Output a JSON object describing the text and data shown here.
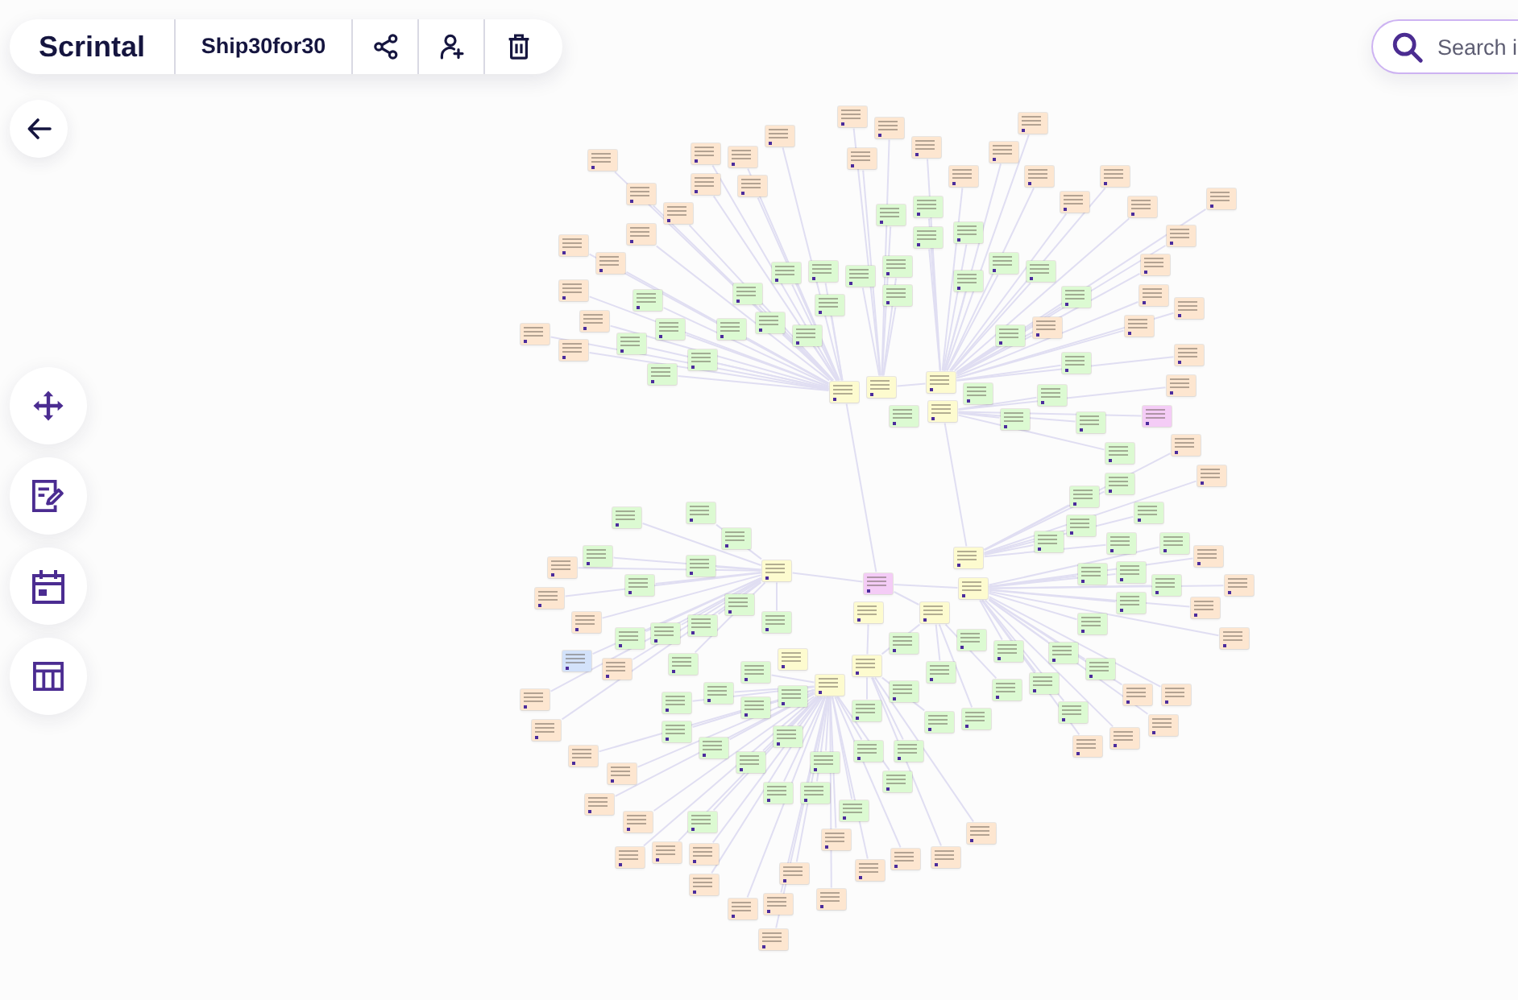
{
  "toolbar": {
    "logo": "Scrintal",
    "board_title": "Ship30for30"
  },
  "search": {
    "placeholder": "Search i"
  },
  "board": {
    "cards": [
      {
        "color": "#fde6d0"
      },
      {
        "color": "#fde6d0"
      },
      {
        "color": "#fde6d0"
      },
      {
        "color": "#fde6d0"
      },
      {
        "color": "#fde6d0"
      },
      {
        "color": "#fde6d0"
      },
      {
        "color": "#fde6d0"
      },
      {
        "color": "#fde6d0"
      },
      {
        "color": "#fde6d0"
      },
      {
        "color": "#fde6d0"
      },
      {
        "color": "#fde6d0"
      },
      {
        "color": "#fde6d0"
      },
      {
        "color": "#fde6d0"
      },
      {
        "color": "#fde6d0"
      },
      {
        "color": "#fde6d0"
      },
      {
        "color": "#fde6d0"
      },
      {
        "color": "#fde6d0"
      },
      {
        "color": "#fde6d0"
      },
      {
        "color": "#fde6d0"
      },
      {
        "color": "#dcfad2"
      },
      {
        "color": "#fde6d0"
      },
      {
        "color": "#dcfad2"
      },
      {
        "color": "#fde6d0"
      },
      {
        "color": "#dcfad2"
      },
      {
        "color": "#dcfad2"
      },
      {
        "color": "#fde6d0"
      },
      {
        "color": "#fde6d0"
      },
      {
        "color": "#dcfad2"
      },
      {
        "color": "#fde6d0"
      },
      {
        "color": "#fde6d0"
      },
      {
        "color": "#dcfad2"
      },
      {
        "color": "#dcfad2"
      },
      {
        "color": "#dcfad2"
      },
      {
        "color": "#dcfad2"
      },
      {
        "color": "#dcfad2"
      },
      {
        "color": "#dcfad2"
      },
      {
        "color": "#fde6d0"
      },
      {
        "color": "#dcfad2"
      },
      {
        "color": "#dcfad2"
      },
      {
        "color": "#dcfad2"
      },
      {
        "color": "#fde6d0"
      },
      {
        "color": "#fde6d0"
      },
      {
        "color": "#dcfad2"
      },
      {
        "color": "#dcfad2"
      },
      {
        "color": "#fde6d0"
      },
      {
        "color": "#dcfad2"
      },
      {
        "color": "#fde6d0"
      },
      {
        "color": "#fde6d0"
      },
      {
        "color": "#dcfad2"
      },
      {
        "color": "#dcfad2"
      },
      {
        "color": "#fde6d0"
      },
      {
        "color": "#dcfad2"
      },
      {
        "color": "#dcfad2"
      },
      {
        "color": "#dcfad2"
      },
      {
        "color": "#fde6d0"
      },
      {
        "color": "#fde6d0"
      },
      {
        "color": "#dcfad2"
      },
      {
        "color": "#dcfad2"
      },
      {
        "color": "#dcfad2"
      },
      {
        "color": "#fdfbcf"
      },
      {
        "color": "#fde6d0"
      },
      {
        "color": "#fdfbcf"
      },
      {
        "color": "#fdfbcf"
      },
      {
        "color": "#dcfad2"
      },
      {
        "color": "#dcfad2"
      },
      {
        "color": "#fdfbcf"
      },
      {
        "color": "#dcfad2"
      },
      {
        "color": "#f4ccf6"
      },
      {
        "color": "#dcfad2"
      },
      {
        "color": "#dcfad2"
      },
      {
        "color": "#fde6d0"
      },
      {
        "color": "#dcfad2"
      },
      {
        "color": "#fde6d0"
      },
      {
        "color": "#dcfad2"
      },
      {
        "color": "#dcfad2"
      },
      {
        "color": "#dcfad2"
      },
      {
        "color": "#dcfad2"
      },
      {
        "color": "#dcfad2"
      },
      {
        "color": "#dcfad2"
      },
      {
        "color": "#dcfad2"
      },
      {
        "color": "#dcfad2"
      },
      {
        "color": "#dcfad2"
      },
      {
        "color": "#dcfad2"
      },
      {
        "color": "#fde6d0"
      },
      {
        "color": "#fdfbcf"
      },
      {
        "color": "#fde6d0"
      },
      {
        "color": "#dcfad2"
      },
      {
        "color": "#dcfad2"
      },
      {
        "color": "#fdfbcf"
      },
      {
        "color": "#dcfad2"
      },
      {
        "color": "#dcfad2"
      },
      {
        "color": "#f4ccf6"
      },
      {
        "color": "#fde6d0"
      },
      {
        "color": "#dcfad2"
      },
      {
        "color": "#fdfbcf"
      },
      {
        "color": "#fde6d0"
      },
      {
        "color": "#dcfad2"
      },
      {
        "color": "#dcfad2"
      },
      {
        "color": "#dcfad2"
      },
      {
        "color": "#fde6d0"
      },
      {
        "color": "#fdfbcf"
      },
      {
        "color": "#fdfbcf"
      },
      {
        "color": "#fde6d0"
      },
      {
        "color": "#dcfad2"
      },
      {
        "color": "#dcfad2"
      },
      {
        "color": "#dcfad2"
      },
      {
        "color": "#dcfad2"
      },
      {
        "color": "#dcfad2"
      },
      {
        "color": "#fde6d0"
      },
      {
        "color": "#dcfad2"
      },
      {
        "color": "#dcfad2"
      },
      {
        "color": "#dcfad2"
      },
      {
        "color": "#dcfad2"
      },
      {
        "color": "#d3e2fa"
      },
      {
        "color": "#fdfbcf"
      },
      {
        "color": "#dcfad2"
      },
      {
        "color": "#fdfbcf"
      },
      {
        "color": "#fde6d0"
      },
      {
        "color": "#dcfad2"
      },
      {
        "color": "#dcfad2"
      },
      {
        "color": "#dcfad2"
      },
      {
        "color": "#dcfad2"
      },
      {
        "color": "#fdfbcf"
      },
      {
        "color": "#dcfad2"
      },
      {
        "color": "#dcfad2"
      },
      {
        "color": "#dcfad2"
      },
      {
        "color": "#fde6d0"
      },
      {
        "color": "#fde6d0"
      },
      {
        "color": "#dcfad2"
      },
      {
        "color": "#fde6d0"
      },
      {
        "color": "#dcfad2"
      },
      {
        "color": "#dcfad2"
      },
      {
        "color": "#dcfad2"
      },
      {
        "color": "#dcfad2"
      },
      {
        "color": "#dcfad2"
      },
      {
        "color": "#dcfad2"
      },
      {
        "color": "#fde6d0"
      },
      {
        "color": "#fde6d0"
      },
      {
        "color": "#dcfad2"
      },
      {
        "color": "#dcfad2"
      },
      {
        "color": "#fde6d0"
      },
      {
        "color": "#dcfad2"
      },
      {
        "color": "#dcfad2"
      },
      {
        "color": "#dcfad2"
      },
      {
        "color": "#fde6d0"
      },
      {
        "color": "#fde6d0"
      },
      {
        "color": "#dcfad2"
      },
      {
        "color": "#dcfad2"
      },
      {
        "color": "#fde6d0"
      },
      {
        "color": "#dcfad2"
      },
      {
        "color": "#dcfad2"
      },
      {
        "color": "#dcfad2"
      },
      {
        "color": "#fde6d0"
      },
      {
        "color": "#dcfad2"
      },
      {
        "color": "#fde6d0"
      },
      {
        "color": "#dcfad2"
      },
      {
        "color": "#fde6d0"
      },
      {
        "color": "#fde6d0"
      },
      {
        "color": "#fde6d0"
      },
      {
        "color": "#fde6d0"
      },
      {
        "color": "#fde6d0"
      },
      {
        "color": "#fde6d0"
      },
      {
        "color": "#fde6d0"
      },
      {
        "color": "#fde6d0"
      },
      {
        "color": "#fde6d0"
      },
      {
        "color": "#fde6d0"
      },
      {
        "color": "#fde6d0"
      },
      {
        "color": "#fde6d0"
      },
      {
        "color": "#fde6d0"
      },
      {
        "color": "#fde6d0"
      }
    ]
  }
}
